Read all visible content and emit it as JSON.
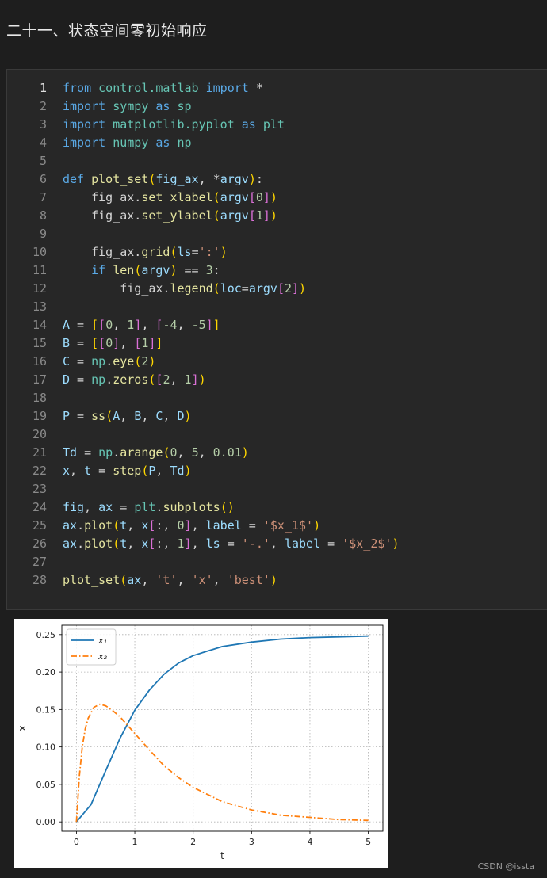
{
  "heading": "二十一、状态空间零初始响应",
  "code": {
    "active_line": 1,
    "lines": [
      [
        [
          "kw",
          "from"
        ],
        [
          "tx",
          " "
        ],
        [
          "mod",
          "control.matlab"
        ],
        [
          "tx",
          " "
        ],
        [
          "kw",
          "import"
        ],
        [
          "tx",
          " *"
        ]
      ],
      [
        [
          "kw",
          "import"
        ],
        [
          "tx",
          " "
        ],
        [
          "mod",
          "sympy"
        ],
        [
          "tx",
          " "
        ],
        [
          "kw",
          "as"
        ],
        [
          "tx",
          " "
        ],
        [
          "mod",
          "sp"
        ]
      ],
      [
        [
          "kw",
          "import"
        ],
        [
          "tx",
          " "
        ],
        [
          "mod",
          "matplotlib.pyplot"
        ],
        [
          "tx",
          " "
        ],
        [
          "kw",
          "as"
        ],
        [
          "tx",
          " "
        ],
        [
          "mod",
          "plt"
        ]
      ],
      [
        [
          "kw",
          "import"
        ],
        [
          "tx",
          " "
        ],
        [
          "mod",
          "numpy"
        ],
        [
          "tx",
          " "
        ],
        [
          "kw",
          "as"
        ],
        [
          "tx",
          " "
        ],
        [
          "mod",
          "np"
        ]
      ],
      [],
      [
        [
          "kw",
          "def"
        ],
        [
          "tx",
          " "
        ],
        [
          "fn",
          "plot_set"
        ],
        [
          "b1",
          "("
        ],
        [
          "var",
          "fig_ax"
        ],
        [
          "tx",
          ", *"
        ],
        [
          "var",
          "argv"
        ],
        [
          "b1",
          ")"
        ],
        [
          "tx",
          ":"
        ]
      ],
      [
        [
          "tx",
          "    fig_ax."
        ],
        [
          "fn",
          "set_xlabel"
        ],
        [
          "b1",
          "("
        ],
        [
          "var",
          "argv"
        ],
        [
          "b2",
          "["
        ],
        [
          "num",
          "0"
        ],
        [
          "b2",
          "]"
        ],
        [
          "b1",
          ")"
        ]
      ],
      [
        [
          "tx",
          "    fig_ax."
        ],
        [
          "fn",
          "set_ylabel"
        ],
        [
          "b1",
          "("
        ],
        [
          "var",
          "argv"
        ],
        [
          "b2",
          "["
        ],
        [
          "num",
          "1"
        ],
        [
          "b2",
          "]"
        ],
        [
          "b1",
          ")"
        ]
      ],
      [],
      [
        [
          "tx",
          "    fig_ax."
        ],
        [
          "fn",
          "grid"
        ],
        [
          "b1",
          "("
        ],
        [
          "var",
          "ls"
        ],
        [
          "tx",
          "="
        ],
        [
          "str",
          "':'"
        ],
        [
          "b1",
          ")"
        ]
      ],
      [
        [
          "tx",
          "    "
        ],
        [
          "kw",
          "if"
        ],
        [
          "tx",
          " "
        ],
        [
          "fn",
          "len"
        ],
        [
          "b1",
          "("
        ],
        [
          "var",
          "argv"
        ],
        [
          "b1",
          ")"
        ],
        [
          "tx",
          " == "
        ],
        [
          "num",
          "3"
        ],
        [
          "tx",
          ":"
        ]
      ],
      [
        [
          "tx",
          "        fig_ax."
        ],
        [
          "fn",
          "legend"
        ],
        [
          "b1",
          "("
        ],
        [
          "var",
          "loc"
        ],
        [
          "tx",
          "="
        ],
        [
          "var",
          "argv"
        ],
        [
          "b2",
          "["
        ],
        [
          "num",
          "2"
        ],
        [
          "b2",
          "]"
        ],
        [
          "b1",
          ")"
        ]
      ],
      [],
      [
        [
          "var",
          "A"
        ],
        [
          "tx",
          " = "
        ],
        [
          "b1",
          "["
        ],
        [
          "b2",
          "["
        ],
        [
          "num",
          "0"
        ],
        [
          "tx",
          ", "
        ],
        [
          "num",
          "1"
        ],
        [
          "b2",
          "]"
        ],
        [
          "tx",
          ", "
        ],
        [
          "b2",
          "["
        ],
        [
          "num",
          "-4"
        ],
        [
          "tx",
          ", "
        ],
        [
          "num",
          "-5"
        ],
        [
          "b2",
          "]"
        ],
        [
          "b1",
          "]"
        ]
      ],
      [
        [
          "var",
          "B"
        ],
        [
          "tx",
          " = "
        ],
        [
          "b1",
          "["
        ],
        [
          "b2",
          "["
        ],
        [
          "num",
          "0"
        ],
        [
          "b2",
          "]"
        ],
        [
          "tx",
          ", "
        ],
        [
          "b2",
          "["
        ],
        [
          "num",
          "1"
        ],
        [
          "b2",
          "]"
        ],
        [
          "b1",
          "]"
        ]
      ],
      [
        [
          "var",
          "C"
        ],
        [
          "tx",
          " = "
        ],
        [
          "mod",
          "np"
        ],
        [
          "tx",
          "."
        ],
        [
          "fn",
          "eye"
        ],
        [
          "b1",
          "("
        ],
        [
          "num",
          "2"
        ],
        [
          "b1",
          ")"
        ]
      ],
      [
        [
          "var",
          "D"
        ],
        [
          "tx",
          " = "
        ],
        [
          "mod",
          "np"
        ],
        [
          "tx",
          "."
        ],
        [
          "fn",
          "zeros"
        ],
        [
          "b1",
          "("
        ],
        [
          "b2",
          "["
        ],
        [
          "num",
          "2"
        ],
        [
          "tx",
          ", "
        ],
        [
          "num",
          "1"
        ],
        [
          "b2",
          "]"
        ],
        [
          "b1",
          ")"
        ]
      ],
      [],
      [
        [
          "var",
          "P"
        ],
        [
          "tx",
          " = "
        ],
        [
          "fn",
          "ss"
        ],
        [
          "b1",
          "("
        ],
        [
          "var",
          "A"
        ],
        [
          "tx",
          ", "
        ],
        [
          "var",
          "B"
        ],
        [
          "tx",
          ", "
        ],
        [
          "var",
          "C"
        ],
        [
          "tx",
          ", "
        ],
        [
          "var",
          "D"
        ],
        [
          "b1",
          ")"
        ]
      ],
      [],
      [
        [
          "var",
          "Td"
        ],
        [
          "tx",
          " = "
        ],
        [
          "mod",
          "np"
        ],
        [
          "tx",
          "."
        ],
        [
          "fn",
          "arange"
        ],
        [
          "b1",
          "("
        ],
        [
          "num",
          "0"
        ],
        [
          "tx",
          ", "
        ],
        [
          "num",
          "5"
        ],
        [
          "tx",
          ", "
        ],
        [
          "num",
          "0.01"
        ],
        [
          "b1",
          ")"
        ]
      ],
      [
        [
          "var",
          "x"
        ],
        [
          "tx",
          ", "
        ],
        [
          "var",
          "t"
        ],
        [
          "tx",
          " = "
        ],
        [
          "fn",
          "step"
        ],
        [
          "b1",
          "("
        ],
        [
          "var",
          "P"
        ],
        [
          "tx",
          ", "
        ],
        [
          "var",
          "Td"
        ],
        [
          "b1",
          ")"
        ]
      ],
      [],
      [
        [
          "var",
          "fig"
        ],
        [
          "tx",
          ", "
        ],
        [
          "var",
          "ax"
        ],
        [
          "tx",
          " = "
        ],
        [
          "mod",
          "plt"
        ],
        [
          "tx",
          "."
        ],
        [
          "fn",
          "subplots"
        ],
        [
          "b1",
          "()"
        ]
      ],
      [
        [
          "var",
          "ax"
        ],
        [
          "tx",
          "."
        ],
        [
          "fn",
          "plot"
        ],
        [
          "b1",
          "("
        ],
        [
          "var",
          "t"
        ],
        [
          "tx",
          ", "
        ],
        [
          "var",
          "x"
        ],
        [
          "b2",
          "["
        ],
        [
          "tx",
          ":, "
        ],
        [
          "num",
          "0"
        ],
        [
          "b2",
          "]"
        ],
        [
          "tx",
          ", "
        ],
        [
          "var",
          "label"
        ],
        [
          "tx",
          " = "
        ],
        [
          "str",
          "'$x_1$'"
        ],
        [
          "b1",
          ")"
        ]
      ],
      [
        [
          "var",
          "ax"
        ],
        [
          "tx",
          "."
        ],
        [
          "fn",
          "plot"
        ],
        [
          "b1",
          "("
        ],
        [
          "var",
          "t"
        ],
        [
          "tx",
          ", "
        ],
        [
          "var",
          "x"
        ],
        [
          "b2",
          "["
        ],
        [
          "tx",
          ":, "
        ],
        [
          "num",
          "1"
        ],
        [
          "b2",
          "]"
        ],
        [
          "tx",
          ", "
        ],
        [
          "var",
          "ls"
        ],
        [
          "tx",
          " = "
        ],
        [
          "str",
          "'-.'"
        ],
        [
          "tx",
          ", "
        ],
        [
          "var",
          "label"
        ],
        [
          "tx",
          " = "
        ],
        [
          "str",
          "'$x_2$'"
        ],
        [
          "b1",
          ")"
        ]
      ],
      [],
      [
        [
          "fn",
          "plot_set"
        ],
        [
          "b1",
          "("
        ],
        [
          "var",
          "ax"
        ],
        [
          "tx",
          ", "
        ],
        [
          "str",
          "'t'"
        ],
        [
          "tx",
          ", "
        ],
        [
          "str",
          "'x'"
        ],
        [
          "tx",
          ", "
        ],
        [
          "str",
          "'best'"
        ],
        [
          "b1",
          ")"
        ]
      ]
    ]
  },
  "chart_data": {
    "type": "line",
    "xlabel": "t",
    "ylabel": "x",
    "xlim": [
      -0.25,
      5.25
    ],
    "ylim": [
      -0.0125,
      0.2625
    ],
    "xticks": [
      0,
      1,
      2,
      3,
      4,
      5
    ],
    "yticks": [
      0.0,
      0.05,
      0.1,
      0.15,
      0.2,
      0.25
    ],
    "ytick_labels": [
      "0.00",
      "0.05",
      "0.10",
      "0.15",
      "0.20",
      "0.25"
    ],
    "grid": true,
    "grid_style": "dotted",
    "legend_position": "top-left",
    "series": [
      {
        "name": "x₁",
        "color": "#1f77b4",
        "linestyle": "solid",
        "x": [
          0,
          0.25,
          0.5,
          0.75,
          1,
          1.25,
          1.5,
          1.75,
          2,
          2.5,
          3,
          3.5,
          4,
          4.5,
          5
        ],
        "y": [
          0,
          0.023,
          0.068,
          0.112,
          0.149,
          0.176,
          0.197,
          0.212,
          0.222,
          0.234,
          0.24,
          0.244,
          0.246,
          0.247,
          0.248
        ]
      },
      {
        "name": "x₂",
        "color": "#ff7f0e",
        "linestyle": "dashdot",
        "x": [
          0,
          0.05,
          0.1,
          0.15,
          0.2,
          0.3,
          0.4,
          0.5,
          0.6,
          0.75,
          1,
          1.25,
          1.5,
          1.75,
          2,
          2.5,
          3,
          3.5,
          4,
          4.5,
          5
        ],
        "y": [
          0,
          0.061,
          0.1,
          0.124,
          0.138,
          0.153,
          0.157,
          0.155,
          0.15,
          0.14,
          0.118,
          0.096,
          0.075,
          0.059,
          0.046,
          0.027,
          0.016,
          0.009,
          0.006,
          0.003,
          0.002
        ]
      }
    ]
  },
  "footer": "CSDN @issta"
}
